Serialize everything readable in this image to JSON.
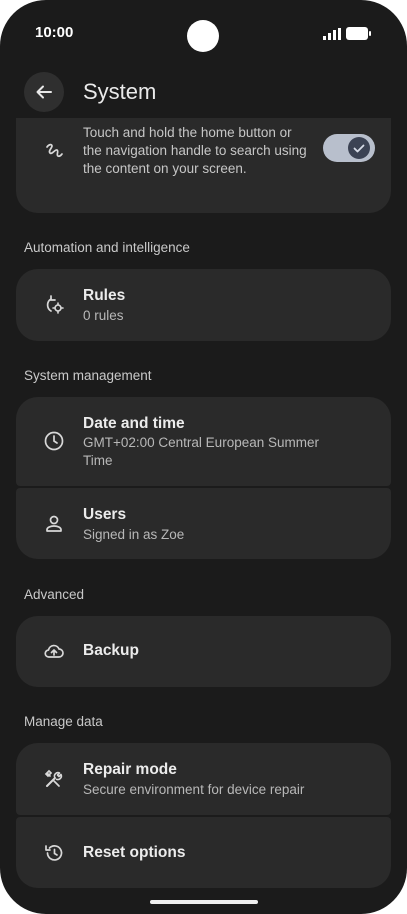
{
  "status": {
    "time": "10:00"
  },
  "header": {
    "title": "System"
  },
  "search_card": {
    "description": "Touch and hold the home button or the navigation handle to search using the content on your screen.",
    "toggle_on": true
  },
  "sections": {
    "automation": "Automation and intelligence",
    "system_management": "System management",
    "advanced": "Advanced",
    "manage_data": "Manage data"
  },
  "items": {
    "rules": {
      "title": "Rules",
      "subtitle": "0 rules"
    },
    "date_time": {
      "title": "Date and time",
      "subtitle_line1": "GMT+02:00 Central European Summer",
      "subtitle_line2": "Time"
    },
    "users": {
      "title": "Users",
      "subtitle": "Signed in as Zoe"
    },
    "backup": {
      "title": "Backup"
    },
    "repair": {
      "title": "Repair mode",
      "subtitle": "Secure environment for device repair"
    },
    "reset": {
      "title": "Reset options"
    }
  },
  "colors": {
    "background": "#1b1b1b",
    "card": "#2a2a2a",
    "toggle_track": "#b8bfcc",
    "toggle_knob": "#3b4253"
  }
}
